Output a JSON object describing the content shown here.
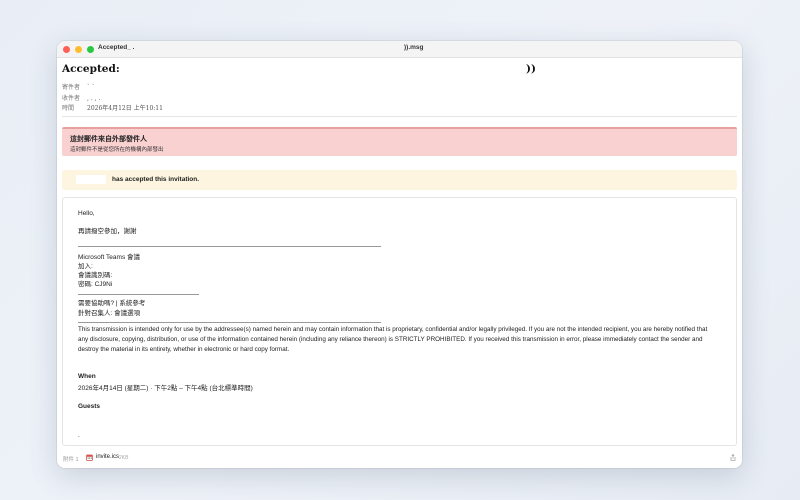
{
  "window": {
    "title_left": "Accepted_ .",
    "title_right": ")).msg"
  },
  "header": {
    "subject_left": "Accepted:",
    "subject_right": "))",
    "from_label": "寄件者",
    "from_value": "` `",
    "to_label": "收件者",
    "to_value": ",  .  ,  .",
    "time_label": "時間",
    "time_value": "2026年4月12日 上午10:11"
  },
  "external_banner": {
    "title": "這封郵件來自外部發件人",
    "subtitle": "這封郵件不是從您所在的機構內部發出"
  },
  "accept_banner": {
    "text": "has accepted this invitation."
  },
  "body": {
    "greeting": "Hello,",
    "thanks": "再請撥空參加，謝謝",
    "teams_title": "Microsoft Teams 會議",
    "join_label": "加入:",
    "meeting_id_label": "會議識別碼:",
    "passcode_label": "密碼: CJ9Ni",
    "help_line": "需要協助嗎? | 系統參考",
    "organizer_line": "針對召集人: 會議選項",
    "disclaimer": "This transmission is intended only for use by the addressee(s) named herein and may contain information that is proprietary, confidential and/or legally privileged. If you are not the intended recipient, you are hereby notified that any disclosure, copying, distribution, or use of the information contained herein (including any reliance thereon) is STRICTLY PROHIBITED. If you received this transmission in error, please immediately contact the sender and destroy the material in its entirety, whether in electronic or hard copy format.",
    "when_label": "When",
    "when_value": "2026年4月14日 (星期二) · 下午2點 – 下午4點 (台北標準時間)",
    "guests_label": "Guests",
    "trailing_dot": "."
  },
  "footer": {
    "attachments_label": "附件 1",
    "attachment_name": "invite.ics",
    "attachment_size": "2KB"
  },
  "colors": {
    "external_banner_bg": "#f9d1d1",
    "accept_banner_bg": "#fdf5df"
  }
}
